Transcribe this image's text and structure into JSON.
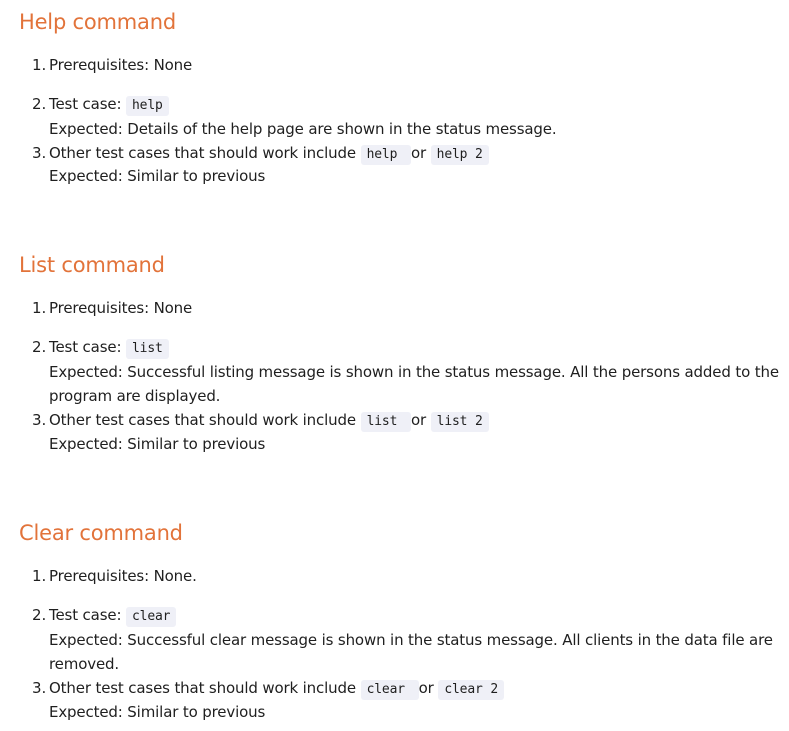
{
  "sections": [
    {
      "title": "Help command",
      "items": [
        {
          "number": "1.",
          "text": "Prerequisites: None"
        },
        {
          "number": "2.",
          "prefix": "Test case: ",
          "code": "help",
          "expected": "Expected: Details of the help page are shown in the status message."
        },
        {
          "number": "3.",
          "prefix": "Other test cases that should work include ",
          "code1": "help ",
          "mid": "or",
          "code2": "help 2",
          "expected": "Expected: Similar to previous"
        }
      ]
    },
    {
      "title": "List command",
      "items": [
        {
          "number": "1.",
          "text": "Prerequisites: None"
        },
        {
          "number": "2.",
          "prefix": "Test case: ",
          "code": "list",
          "expected": "Expected: Successful listing message is shown in the status message. All the persons added to the",
          "expected2": "program are displayed."
        },
        {
          "number": "3.",
          "prefix": "Other test cases that should work include ",
          "code1": "list ",
          "mid": "or",
          "code2": "list 2",
          "expected": "Expected: Similar to previous"
        }
      ]
    },
    {
      "title": "Clear command",
      "items": [
        {
          "number": "1.",
          "text": "Prerequisites: None."
        },
        {
          "number": "2.",
          "prefix": "Test case: ",
          "code": "clear",
          "expected": "Expected: Successful clear message is shown in the status message. All clients in the data file are",
          "expected2": "removed."
        },
        {
          "number": "3.",
          "prefix": "Other test cases that should work include ",
          "code1": "clear ",
          "mid": "or",
          "code2": "clear 2",
          "expected": "Expected: Similar to previous"
        }
      ]
    }
  ]
}
